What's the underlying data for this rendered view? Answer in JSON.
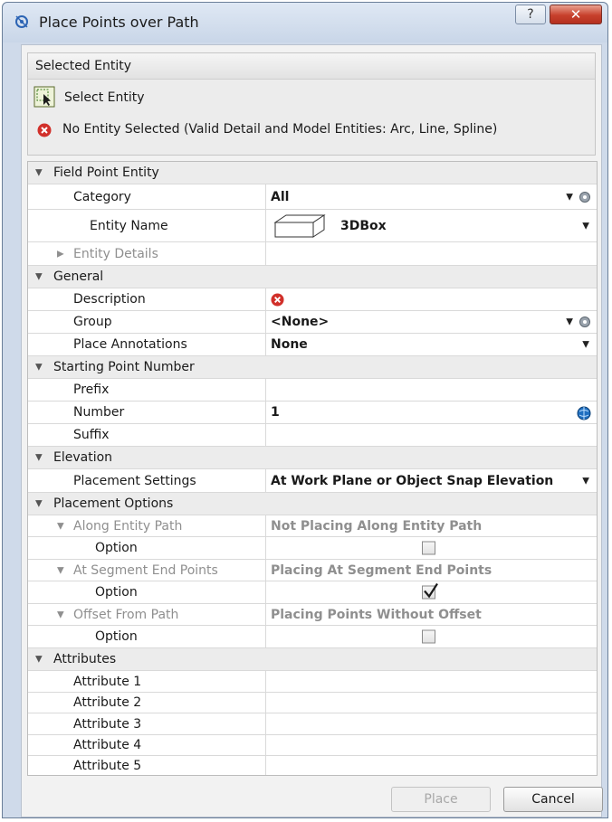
{
  "window": {
    "title": "Place Points over Path",
    "help_label": "?",
    "close_label": "✕"
  },
  "selected_entity": {
    "header": "Selected Entity",
    "select_button_label": "Select Entity",
    "status_message": "No Entity Selected (Valid Detail and Model Entities: Arc, Line, Spline)"
  },
  "grid": {
    "field_point_entity": {
      "header": "Field Point Entity",
      "category": {
        "label": "Category",
        "value": "All"
      },
      "entity_name": {
        "label": "Entity Name",
        "value": "3DBox"
      },
      "entity_details": {
        "label": "Entity Details"
      }
    },
    "general": {
      "header": "General",
      "description": {
        "label": "Description"
      },
      "group": {
        "label": "Group",
        "value": "<None>"
      },
      "place_annotations": {
        "label": "Place Annotations",
        "value": "None"
      }
    },
    "starting_point_number": {
      "header": "Starting Point Number",
      "prefix": {
        "label": "Prefix",
        "value": ""
      },
      "number": {
        "label": "Number",
        "value": "1"
      },
      "suffix": {
        "label": "Suffix",
        "value": ""
      }
    },
    "elevation": {
      "header": "Elevation",
      "placement_settings": {
        "label": "Placement Settings",
        "value": "At Work Plane or Object Snap Elevation"
      }
    },
    "placement_options": {
      "header": "Placement Options",
      "along_entity_path": {
        "label": "Along Entity Path",
        "value": "Not Placing Along Entity Path",
        "option_label": "Option",
        "checked": false
      },
      "at_segment_end_points": {
        "label": "At Segment End Points",
        "value": "Placing At Segment End Points",
        "option_label": "Option",
        "checked": true
      },
      "offset_from_path": {
        "label": "Offset From Path",
        "value": "Placing Points Without Offset",
        "option_label": "Option",
        "checked": false
      }
    },
    "attributes": {
      "header": "Attributes",
      "items": [
        {
          "label": "Attribute 1",
          "value": ""
        },
        {
          "label": "Attribute 2",
          "value": ""
        },
        {
          "label": "Attribute 3",
          "value": ""
        },
        {
          "label": "Attribute 4",
          "value": ""
        },
        {
          "label": "Attribute 5",
          "value": ""
        }
      ]
    }
  },
  "footer": {
    "place_label": "Place",
    "cancel_label": "Cancel"
  },
  "colors": {
    "error_red": "#d1302a",
    "window_frame": "#cfdaea",
    "close_red": "#c7402c"
  }
}
